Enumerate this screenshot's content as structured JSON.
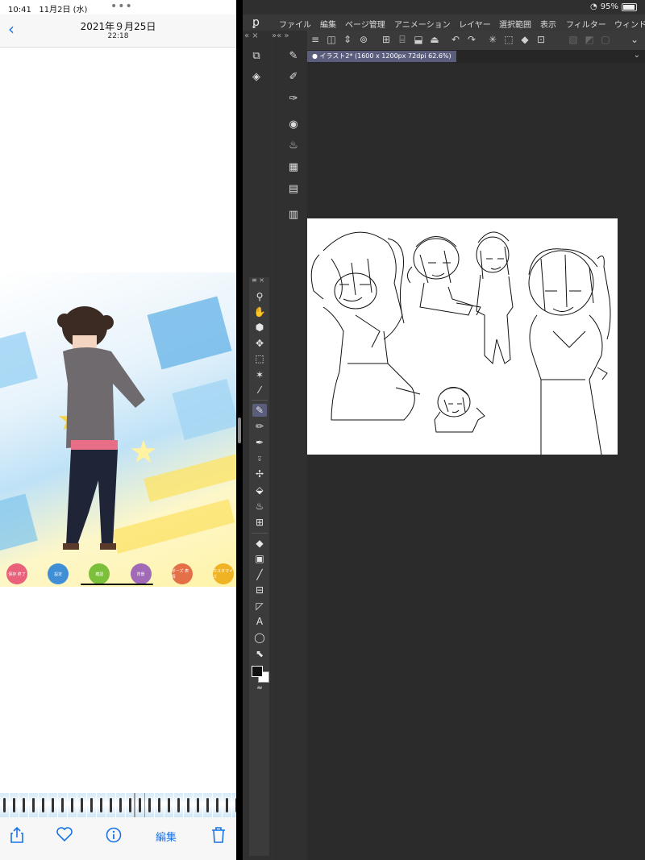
{
  "status": {
    "time": "10:41",
    "date": "11月2日 (水)",
    "battery": "95%"
  },
  "photos": {
    "back_icon": "chevron-left-icon",
    "date": "2021年９月25日",
    "time": "22:18",
    "photo_buttons": [
      {
        "label": "保存 終了",
        "color": "#e9617a"
      },
      {
        "label": "設定",
        "color": "#3f8ed6"
      },
      {
        "label": "確認",
        "color": "#7bbf3b"
      },
      {
        "label": "背景",
        "color": "#a06ab7"
      },
      {
        "label": "ポーズ 表情",
        "color": "#e47048"
      },
      {
        "label": "カスタマイズ",
        "color": "#f0b323"
      }
    ],
    "toolbar": {
      "share_icon": "share-icon",
      "favorite_icon": "heart-icon",
      "info_icon": "info-icon",
      "edit_label": "編集",
      "delete_icon": "trash-icon"
    }
  },
  "csp": {
    "menu": [
      "ファイル",
      "編集",
      "ページ管理",
      "アニメーション",
      "レイヤー",
      "選択範囲",
      "表示",
      "フィルター",
      "ウィンド"
    ],
    "panel_arrows_left": "« ×",
    "panel_arrows_right": "»« »",
    "tab_label": "● イラスト2* (1600 x 1200px 72dpi 62.6%)",
    "toolpal_header": "≡ ×"
  }
}
